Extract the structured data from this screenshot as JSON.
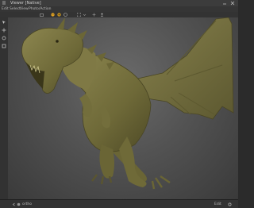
{
  "window": {
    "title": "Viewer [Native]"
  },
  "menu": {
    "items": [
      "Edit",
      "Select",
      "View",
      "Photo/Action"
    ]
  },
  "statusbar": {
    "left_text": "ortho",
    "right_text": "Edit"
  },
  "colors": {
    "sculpt": "#7a7440",
    "background": "#555555",
    "accent": "#e0a020"
  },
  "icons": {
    "toolbar": [
      "camera-icon",
      "light-icon",
      "material-icon",
      "render-icon",
      "frame-icon",
      "grid-icon",
      "user-icon"
    ],
    "lefttools": [
      "select-icon",
      "move-icon",
      "rotate-icon",
      "scale-icon"
    ]
  }
}
